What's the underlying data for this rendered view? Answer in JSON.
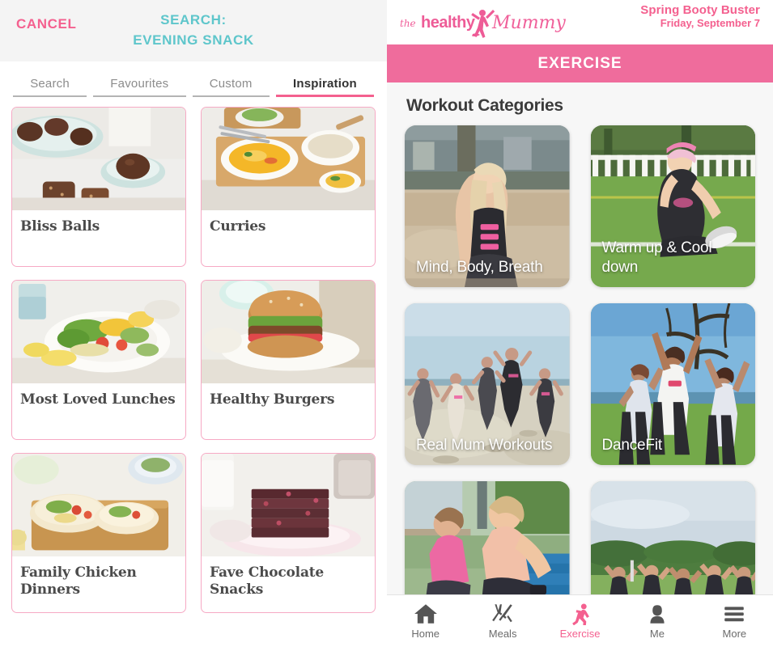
{
  "left": {
    "header": {
      "cancel_label": "CANCEL",
      "search_line1": "SEARCH:",
      "search_line2": "EVENING SNACK"
    },
    "tabs": [
      {
        "label": "Search",
        "active": false
      },
      {
        "label": "Favourites",
        "active": false
      },
      {
        "label": "Custom",
        "active": false
      },
      {
        "label": "Inspiration",
        "active": true
      }
    ],
    "recipe_cards": [
      {
        "label": "Bliss Balls",
        "image": "bliss-balls-photo"
      },
      {
        "label": "Curries",
        "image": "curries-photo"
      },
      {
        "label": "Most Loved Lunches",
        "image": "salad-photo"
      },
      {
        "label": "Healthy Burgers",
        "image": "burger-photo"
      },
      {
        "label": "Family Chicken Dinners",
        "image": "chicken-wraps-photo"
      },
      {
        "label": "Fave Chocolate Snacks",
        "image": "chocolate-slice-photo"
      }
    ]
  },
  "right": {
    "logo": {
      "the": "the",
      "healthy": "healthy",
      "mummy": "Mummy"
    },
    "campaign": {
      "title": "Spring Booty Buster",
      "date": "Friday, September 7"
    },
    "banner_title": "EXERCISE",
    "section_title": "Workout Categories",
    "workout_cards": [
      {
        "label": "Mind, Body, Breath",
        "image": "beach-woman-photo"
      },
      {
        "label": "Warm up & Cool down",
        "image": "stretching-woman-photo"
      },
      {
        "label": "Real Mum Workouts",
        "image": "group-beach-photo"
      },
      {
        "label": "DanceFit",
        "image": "dance-group-photo"
      },
      {
        "label": "",
        "image": "bench-dips-photo"
      },
      {
        "label": "",
        "image": "field-group-photo"
      }
    ],
    "nav": [
      {
        "label": "Home",
        "icon": "home-icon",
        "active": false
      },
      {
        "label": "Meals",
        "icon": "cutlery-icon",
        "active": false
      },
      {
        "label": "Exercise",
        "icon": "runner-icon",
        "active": true
      },
      {
        "label": "Me",
        "icon": "person-icon",
        "active": false
      },
      {
        "label": "More",
        "icon": "hamburger-icon",
        "active": false
      }
    ]
  },
  "colors": {
    "pink": "#f4608f",
    "banner_pink": "#ef6c9c",
    "teal": "#5ec6cb",
    "card_border_pink": "#f6a9c4"
  }
}
